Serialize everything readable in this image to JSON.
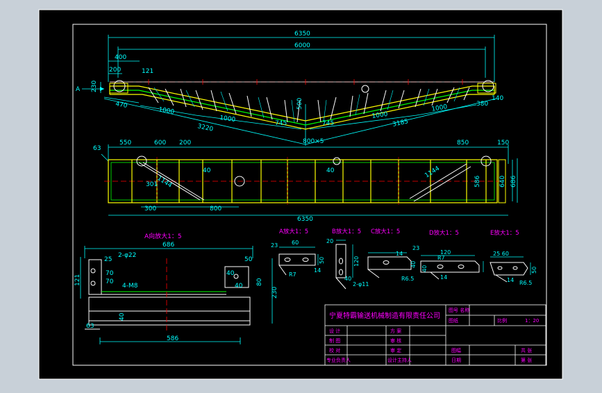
{
  "colors": {
    "outer_bg": "#c8d0d8",
    "sheet": "#000000",
    "border": "#ffffff",
    "dimension": "#00ffff",
    "structure": "#ffff00",
    "steel": "#00ff00",
    "centerline": "#ff0000",
    "title_text": "#ff00ff"
  },
  "top_view": {
    "dim_overall": "6350",
    "dim_inner": "6000",
    "dim_400": "400",
    "dim_200": "200",
    "dim_121": "121",
    "dim_230": "230",
    "view_marker": "A",
    "dim_470": "470",
    "dim_1000_a": "1000",
    "dim_1000_b": "1000",
    "dim_1000_c": "1000",
    "dim_1000_d": "1000",
    "dim_3220": "3220",
    "dim_3185": "3185",
    "dim_745_a": "745",
    "dim_745_b": "745",
    "dim_500": "500",
    "dim_800x5": "800×5",
    "dim_380": "380",
    "dim_140": "140"
  },
  "plan_view": {
    "dim_63": "63",
    "dim_550": "550",
    "dim_600": "600",
    "dim_200": "200",
    "dim_850": "850",
    "dim_150": "150",
    "dim_40_a": "40",
    "dim_40_b": "40",
    "dim_301": "301",
    "dim_1144_a": "1144",
    "dim_1144_b": "1144",
    "dim_586": "586",
    "dim_640": "640",
    "dim_686": "686",
    "dim_300": "300",
    "dim_800": "800",
    "dim_6350": "6350"
  },
  "detail_a_dir": {
    "title": "A向放大1：5",
    "dim_686": "686",
    "dim_25": "25",
    "dim_2phi22": "2-φ22",
    "dim_70_a": "70",
    "dim_70_b": "70",
    "dim_121": "121",
    "dim_4m8": "4-M8",
    "dim_50": "50",
    "dim_40_a": "40",
    "dim_40_b": "40",
    "dim_40_c": "40",
    "dim_80": "80",
    "dim_230": "230",
    "dim_63": "63",
    "dim_586": "586"
  },
  "details": {
    "a_title": "A放大1：5",
    "b_title": "B放大1：5",
    "c_title": "C放大1：5",
    "d_title": "D放大1：5",
    "e_title": "E放大1：5",
    "a_dim_23": "23",
    "a_dim_60": "60",
    "a_dim_50": "50",
    "a_dim_14": "14",
    "a_dim_r7": "R7",
    "b_dim_20": "20",
    "b_dim_120": "120",
    "b_dim_40": "40",
    "b_dim_2phi11": "2-φ11",
    "c_dim_14": "14",
    "c_dim_23": "23",
    "c_dim_r65": "R6.5",
    "c_dim_40": "40",
    "d_dim_120": "120",
    "d_dim_r7": "R7",
    "d_dim_40": "40",
    "d_dim_14": "14",
    "e_dim_2560": "25  60",
    "e_dim_50": "50",
    "e_dim_14": "14",
    "e_dim_r65": "R6.5"
  },
  "title_block": {
    "company": "宁夏特霸输送机械制造有限责任公司",
    "drawing_no_label": "图号 名称",
    "drawing_label": "图纸",
    "scale_label": "比例",
    "scale_value": "1：20",
    "design": "设 计",
    "drawing": "制 图",
    "check": "校 对",
    "process_review": "专业负责人",
    "plan": "方 案",
    "audit": "审 核",
    "approve": "审 定",
    "project_lead": "设计主持人",
    "sheet_label": "图幅",
    "date_label": "日期",
    "total_label": "共 张",
    "page_label": "第 张"
  }
}
